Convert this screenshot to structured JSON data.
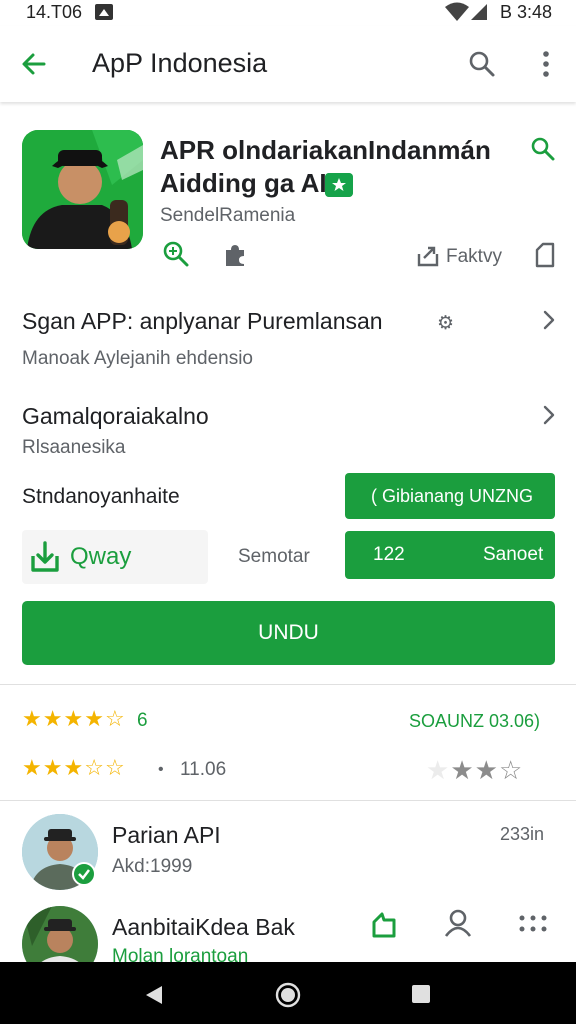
{
  "status_bar": {
    "time": "14.T06",
    "right_text": "B 3:48"
  },
  "app_bar": {
    "title": "ApP Indonesia"
  },
  "app": {
    "title_line1": "APR olndariakanIndanmán",
    "title_line2": "Aidding ga AIP",
    "developer": "SendelRamenia",
    "share_label": "Faktvy"
  },
  "rows": [
    {
      "title": "Sgan APP: anplyanar Puremlansan",
      "subtitle": "Manoak  Aylejanih ehdensio"
    },
    {
      "title": "Gamalqoraiakalno",
      "subtitle": "Rlsaanesika"
    }
  ],
  "action_row": {
    "label": "Stndanoyanhaite",
    "green_button": "( Gibianang UNZNG"
  },
  "download_row": {
    "quick_label": "Qway",
    "middle_label": "Semotar",
    "count": "122",
    "right_label": "Sanoet"
  },
  "install_button": "UNDU",
  "ratings": {
    "row1_score": "6",
    "row1_right": "SOAUNZ 03.06)",
    "row1_stars": 3.5,
    "row2_value": "11.06",
    "row2_stars": 3.5
  },
  "reviews": [
    {
      "name": "Parian API",
      "sub": "Akd:1999",
      "time": "233in"
    },
    {
      "name": "AanbitaiKdea Bak",
      "sub": "Molan lorantoan"
    }
  ],
  "colors": {
    "accent_green": "#1b9e3e",
    "star_yellow": "#f4b400"
  },
  "icons": [
    "back-arrow-icon",
    "search-icon",
    "more-vert-icon",
    "zoom-icon",
    "puzzle-icon",
    "share-icon",
    "bookmark-icon",
    "chevron-right-icon",
    "download-icon",
    "star-icon",
    "check-icon",
    "thumb-icon",
    "person-icon",
    "grid-dots-icon"
  ]
}
